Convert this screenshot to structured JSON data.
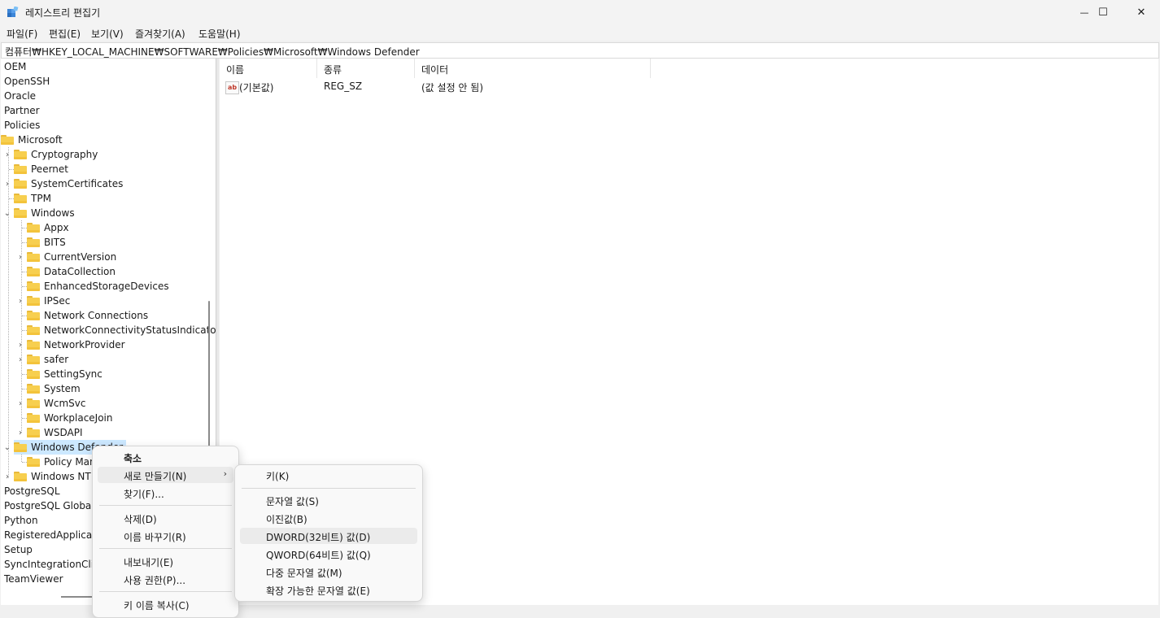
{
  "window": {
    "title": "레지스트리 편집기",
    "minimize_glyph": "—",
    "maximize_glyph": "☐",
    "close_glyph": "✕"
  },
  "menu": [
    "파일(F)",
    "편집(E)",
    "보기(V)",
    "즐겨찾기(A)",
    "도움말(H)"
  ],
  "address": "컴퓨터₩HKEY_LOCAL_MACHINE₩SOFTWARE₩Policies₩Microsoft₩Windows Defender",
  "tree": {
    "top_items": [
      "OEM",
      "OpenSSH",
      "Oracle",
      "Partner",
      "Policies"
    ],
    "microsoft": "Microsoft",
    "microsoft_children": [
      "Cryptography",
      "Peernet",
      "SystemCertificates",
      "TPM"
    ],
    "windows": "Windows",
    "windows_children": [
      "Appx",
      "BITS",
      "CurrentVersion",
      "DataCollection",
      "EnhancedStorageDevices",
      "IPSec",
      "Network Connections",
      "NetworkConnectivityStatusIndicator",
      "NetworkProvider",
      "safer",
      "SettingSync",
      "System",
      "WcmSvc",
      "WorkplaceJoin",
      "WSDAPI"
    ],
    "windows_defender": "Windows Defender",
    "policy_manager": "Policy Manager",
    "windows_nt": "Windows NT",
    "bottom_items": [
      "PostgreSQL",
      "PostgreSQL Global Development Group",
      "Python",
      "RegisteredApplications",
      "Setup",
      "SyncIntegrationClients",
      "TeamViewer"
    ]
  },
  "list": {
    "columns": [
      "이름",
      "종류",
      "데이터"
    ],
    "rows": [
      {
        "name": "(기본값)",
        "type": "REG_SZ",
        "data": "(값 설정 안 됨)"
      }
    ],
    "ab_icon_text": "ab"
  },
  "context_menu": {
    "items": [
      "축소",
      "새로 만들기(N)",
      "찾기(F)...",
      "삭제(D)",
      "이름 바꾸기(R)",
      "내보내기(E)",
      "사용 권한(P)...",
      "키 이름 복사(C)"
    ],
    "arrow": "›"
  },
  "submenu": {
    "items": [
      "키(K)",
      "문자열 값(S)",
      "이진값(B)",
      "DWORD(32비트) 값(D)",
      "QWORD(64비트) 값(Q)",
      "다중 문자열 값(M)",
      "확장 가능한 문자열 값(E)"
    ]
  }
}
